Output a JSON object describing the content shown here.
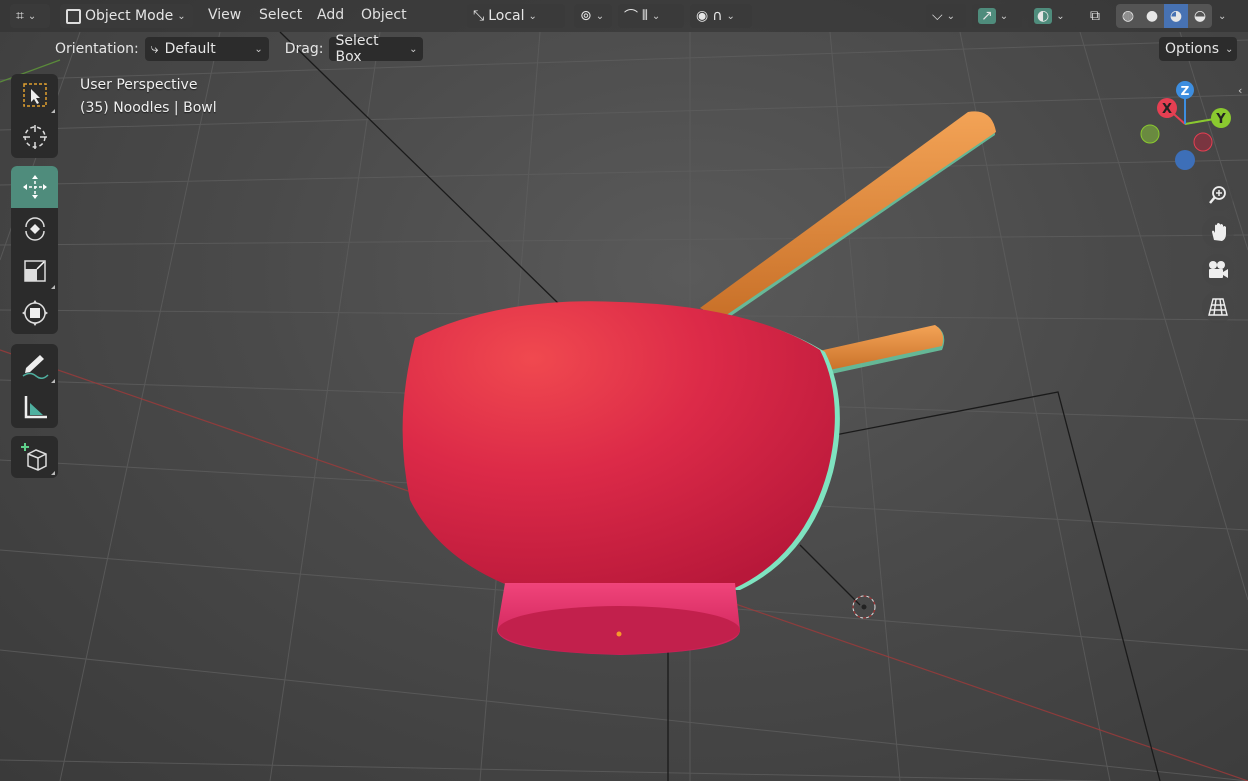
{
  "header": {
    "mode_label": "Object Mode",
    "menus": [
      "View",
      "Select",
      "Add",
      "Object"
    ],
    "transform_orientation": "Local",
    "options_label": "Options"
  },
  "tool_header": {
    "orientation_label": "Orientation:",
    "orientation_value": "Default",
    "drag_label": "Drag:",
    "drag_value": "Select Box"
  },
  "viewport": {
    "perspective_label": "User Perspective",
    "object_info": "(35) Noodles | Bowl"
  },
  "gizmo": {
    "x": "X",
    "y": "Y",
    "z": "Z"
  },
  "toolbar": {
    "tools": [
      "select-box",
      "cursor",
      "move",
      "rotate",
      "scale",
      "transform",
      "annotate",
      "measure",
      "add-cube"
    ],
    "active_tool": "move"
  },
  "colors": {
    "bowl": "#e0304f",
    "bowl_base": "#e8336a",
    "chopsticks": "#e08a3c",
    "active_tool": "#4f8c7c",
    "axis_x": "#e53f52",
    "axis_y": "#8ac92f",
    "axis_z": "#3d8ee0"
  }
}
